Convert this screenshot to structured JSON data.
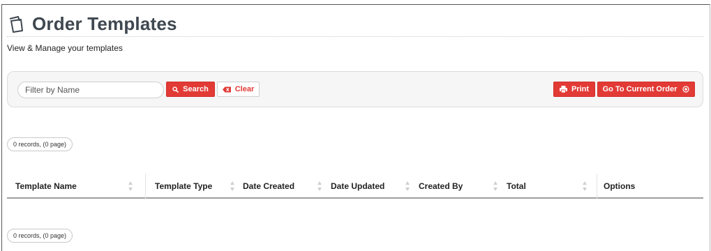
{
  "header": {
    "title": "Order Templates",
    "subtitle": "View & Manage your templates",
    "icon": "templates-icon"
  },
  "filter": {
    "placeholder": "Filter by Name",
    "value": "",
    "search_label": "Search",
    "clear_label": "Clear",
    "print_label": "Print",
    "current_order_label": "Go To Current Order"
  },
  "pager": {
    "top": "0 records, (0 page)",
    "bottom": "0 records, (0 page)"
  },
  "table": {
    "columns": [
      "Template Name",
      "Template Type",
      "Date Created",
      "Date Updated",
      "Created By",
      "Total",
      "Options"
    ]
  },
  "colors": {
    "accent": "#e23a35",
    "title": "#3f4750",
    "panel": "#f6f6f6"
  }
}
